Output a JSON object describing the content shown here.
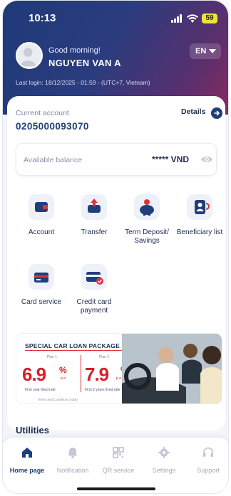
{
  "status_bar": {
    "time": "10:13",
    "battery": "59"
  },
  "header": {
    "greeting": "Good morning!",
    "user_name": "NGUYEN VAN A",
    "language": "EN",
    "last_login": "Last login: 18/12/2025 - 01:59 - (UTC+7, Vietnam)"
  },
  "account": {
    "label": "Current account",
    "number": "0205000093070",
    "details_label": "Details"
  },
  "balance": {
    "label": "Available balance",
    "value": "***** VND"
  },
  "services": [
    {
      "label": "Account",
      "icon": "wallet-icon"
    },
    {
      "label": "Transfer",
      "icon": "transfer-icon"
    },
    {
      "label": "Term Deposit/ Savings",
      "icon": "piggy-bank-icon"
    },
    {
      "label": "Beneficiary list",
      "icon": "beneficiary-icon"
    },
    {
      "label": "Card service",
      "icon": "card-icon"
    },
    {
      "label": "Credit card payment",
      "icon": "credit-card-payment-icon"
    }
  ],
  "banner": {
    "title": "SPECIAL CAR LOAN PACKAGE",
    "plan1": {
      "name": "Plan 1",
      "rate": "6.9",
      "unit": "%",
      "pa": "p.a",
      "fixed": "First year fixed rate"
    },
    "plan2": {
      "name": "Plan 2",
      "rate": "7.9",
      "unit": "%",
      "pa": "p.a",
      "fixed": "First 2 years fixed rate"
    },
    "footnote": "Terms and Conditions Apply"
  },
  "utilities_title": "Utilities",
  "bottom_nav": [
    {
      "label": "Home page",
      "icon": "home-icon",
      "active": true
    },
    {
      "label": "Notification",
      "icon": "bell-icon",
      "active": false
    },
    {
      "label": "QR service",
      "icon": "qr-icon",
      "active": false
    },
    {
      "label": "Settings",
      "icon": "gear-icon",
      "active": false
    },
    {
      "label": "Support",
      "icon": "headset-icon",
      "active": false
    }
  ],
  "colors": {
    "brand": "#1f3f7a",
    "accent_red": "#d6202a",
    "header_start": "#1f3a78",
    "header_end": "#8a2a5c"
  }
}
